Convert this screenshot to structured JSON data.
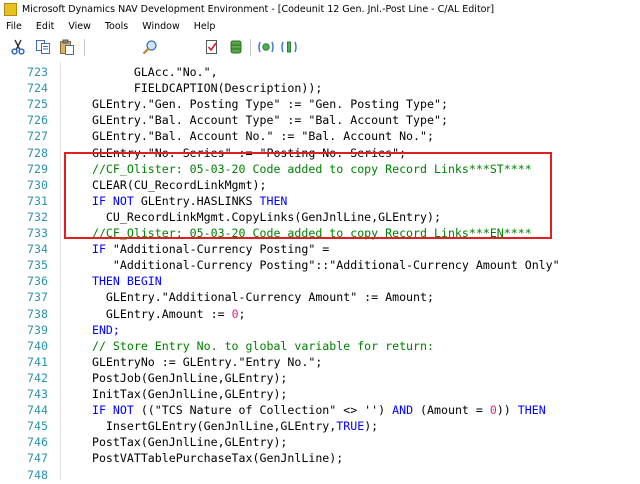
{
  "window": {
    "title": "Microsoft Dynamics NAV Development Environment - [Codeunit 12 Gen. Jnl.-Post Line - C/AL Editor]"
  },
  "menu": [
    "File",
    "Edit",
    "View",
    "Tools",
    "Window",
    "Help"
  ],
  "toolbar": {
    "buttons": [
      {
        "name": "cut-icon"
      },
      {
        "name": "copy-icon"
      },
      {
        "name": "paste-icon"
      },
      {
        "name": "find-icon"
      },
      {
        "name": "compile-icon"
      },
      {
        "name": "database-icon"
      },
      {
        "name": "debug-icon"
      },
      {
        "name": "breakpoint-icon"
      }
    ]
  },
  "editor": {
    "lines": [
      {
        "no": "723",
        "segs": [
          {
            "t": "        GLAcc.\"No.\","
          }
        ]
      },
      {
        "no": "724",
        "segs": [
          {
            "t": "        FIELDCAPTION(Description));"
          }
        ]
      },
      {
        "no": "725",
        "segs": [
          {
            "t": "  GLEntry.\"Gen. Posting Type\" := \"Gen. Posting Type\";"
          }
        ]
      },
      {
        "no": "726",
        "segs": [
          {
            "t": "  GLEntry.\"Bal. Account Type\" := \"Bal. Account Type\";"
          }
        ]
      },
      {
        "no": "727",
        "segs": [
          {
            "t": "  GLEntry.\"Bal. Account No.\" := \"Bal. Account No.\";"
          }
        ]
      },
      {
        "no": "728",
        "segs": [
          {
            "t": "  GLEntry.\"No. Series\" := \"Posting No. Series\";"
          }
        ]
      },
      {
        "no": "729",
        "segs": [
          {
            "t": "  //CF_Olister: 05-03-20 Code added to copy Record Links***ST****",
            "c": "cm"
          }
        ]
      },
      {
        "no": "730",
        "segs": [
          {
            "t": "  CLEAR(CU_RecordLinkMgmt);"
          }
        ]
      },
      {
        "no": "731",
        "segs": [
          {
            "t": "  IF NOT",
            "c": "kw"
          },
          {
            "t": " GLEntry.HASLINKS "
          },
          {
            "t": "THEN",
            "c": "kw"
          }
        ]
      },
      {
        "no": "732",
        "segs": [
          {
            "t": "    CU_RecordLinkMgmt.CopyLinks(GenJnlLine,GLEntry);"
          }
        ]
      },
      {
        "no": "733",
        "segs": [
          {
            "t": "  //CF_Olister: 05-03-20 Code added to copy Record Links***EN****",
            "c": "cm"
          }
        ]
      },
      {
        "no": "734",
        "segs": [
          {
            "t": "  IF",
            "c": "kw"
          },
          {
            "t": " \"Additional-Currency Posting\" ="
          }
        ]
      },
      {
        "no": "735",
        "segs": [
          {
            "t": "     \"Additional-Currency Posting\"::\"Additional-Currency Amount Only\""
          }
        ]
      },
      {
        "no": "736",
        "segs": [
          {
            "t": "  THEN BEGIN",
            "c": "kw"
          }
        ]
      },
      {
        "no": "737",
        "segs": [
          {
            "t": "    GLEntry.\"Additional-Currency Amount\" := Amount;"
          }
        ]
      },
      {
        "no": "738",
        "segs": [
          {
            "t": "    GLEntry.Amount := "
          },
          {
            "t": "0",
            "c": "num"
          },
          {
            "t": ";"
          }
        ]
      },
      {
        "no": "739",
        "segs": [
          {
            "t": "  END;",
            "c": "kw"
          }
        ]
      },
      {
        "no": "740",
        "segs": [
          {
            "t": "  // Store Entry No. to global variable for return:",
            "c": "cm"
          }
        ]
      },
      {
        "no": "741",
        "segs": [
          {
            "t": "  GLEntryNo := GLEntry.\"Entry No.\";"
          }
        ]
      },
      {
        "no": "742",
        "segs": [
          {
            "t": "  PostJob(GenJnlLine,GLEntry);"
          }
        ]
      },
      {
        "no": "743",
        "segs": [
          {
            "t": "  InitTax(GenJnlLine,GLEntry);"
          }
        ]
      },
      {
        "no": "744",
        "segs": [
          {
            "t": "  IF NOT",
            "c": "kw"
          },
          {
            "t": " ((\"TCS Nature of Collection\" <> '') "
          },
          {
            "t": "AND",
            "c": "kw"
          },
          {
            "t": " (Amount = "
          },
          {
            "t": "0",
            "c": "num"
          },
          {
            "t": ")) "
          },
          {
            "t": "THEN",
            "c": "kw"
          }
        ]
      },
      {
        "no": "745",
        "segs": [
          {
            "t": "    InsertGLEntry(GenJnlLine,GLEntry,"
          },
          {
            "t": "TRUE",
            "c": "kw"
          },
          {
            "t": ");"
          }
        ]
      },
      {
        "no": "746",
        "segs": [
          {
            "t": "  PostTax(GenJnlLine,GLEntry);"
          }
        ]
      },
      {
        "no": "747",
        "segs": [
          {
            "t": "  PostVATTablePurchaseTax(GenJnlLine);"
          }
        ]
      },
      {
        "no": "748",
        "segs": [
          {
            "t": ""
          }
        ]
      }
    ]
  },
  "colors": {
    "line_number": "#2b91af",
    "keyword": "#0000ff",
    "comment": "#008000",
    "number": "#e0218a",
    "highlight_border": "#e02020"
  }
}
